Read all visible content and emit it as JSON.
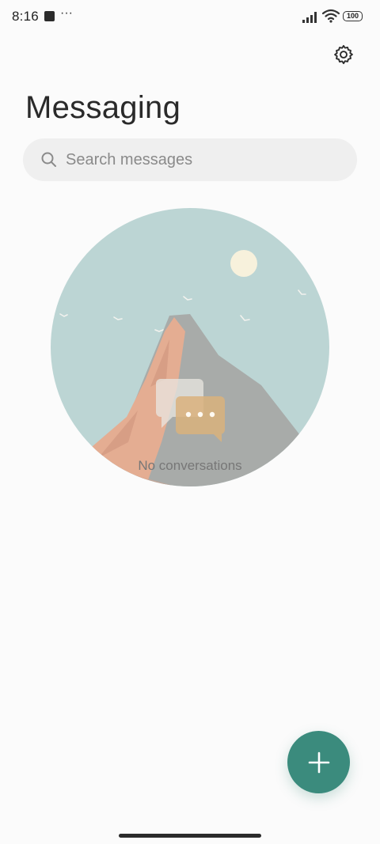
{
  "status_bar": {
    "time": "8:16",
    "more": "···",
    "battery": "100"
  },
  "header": {
    "title": "Messaging",
    "settings_icon": "gear-icon"
  },
  "search": {
    "placeholder": "Search messages",
    "icon": "search-icon"
  },
  "empty_state": {
    "message": "No conversations"
  },
  "fab": {
    "icon": "plus-icon",
    "color": "#3b8b7d"
  },
  "colors": {
    "background": "#fbfbfb",
    "search_background": "#efefef",
    "accent": "#3b8b7d"
  }
}
